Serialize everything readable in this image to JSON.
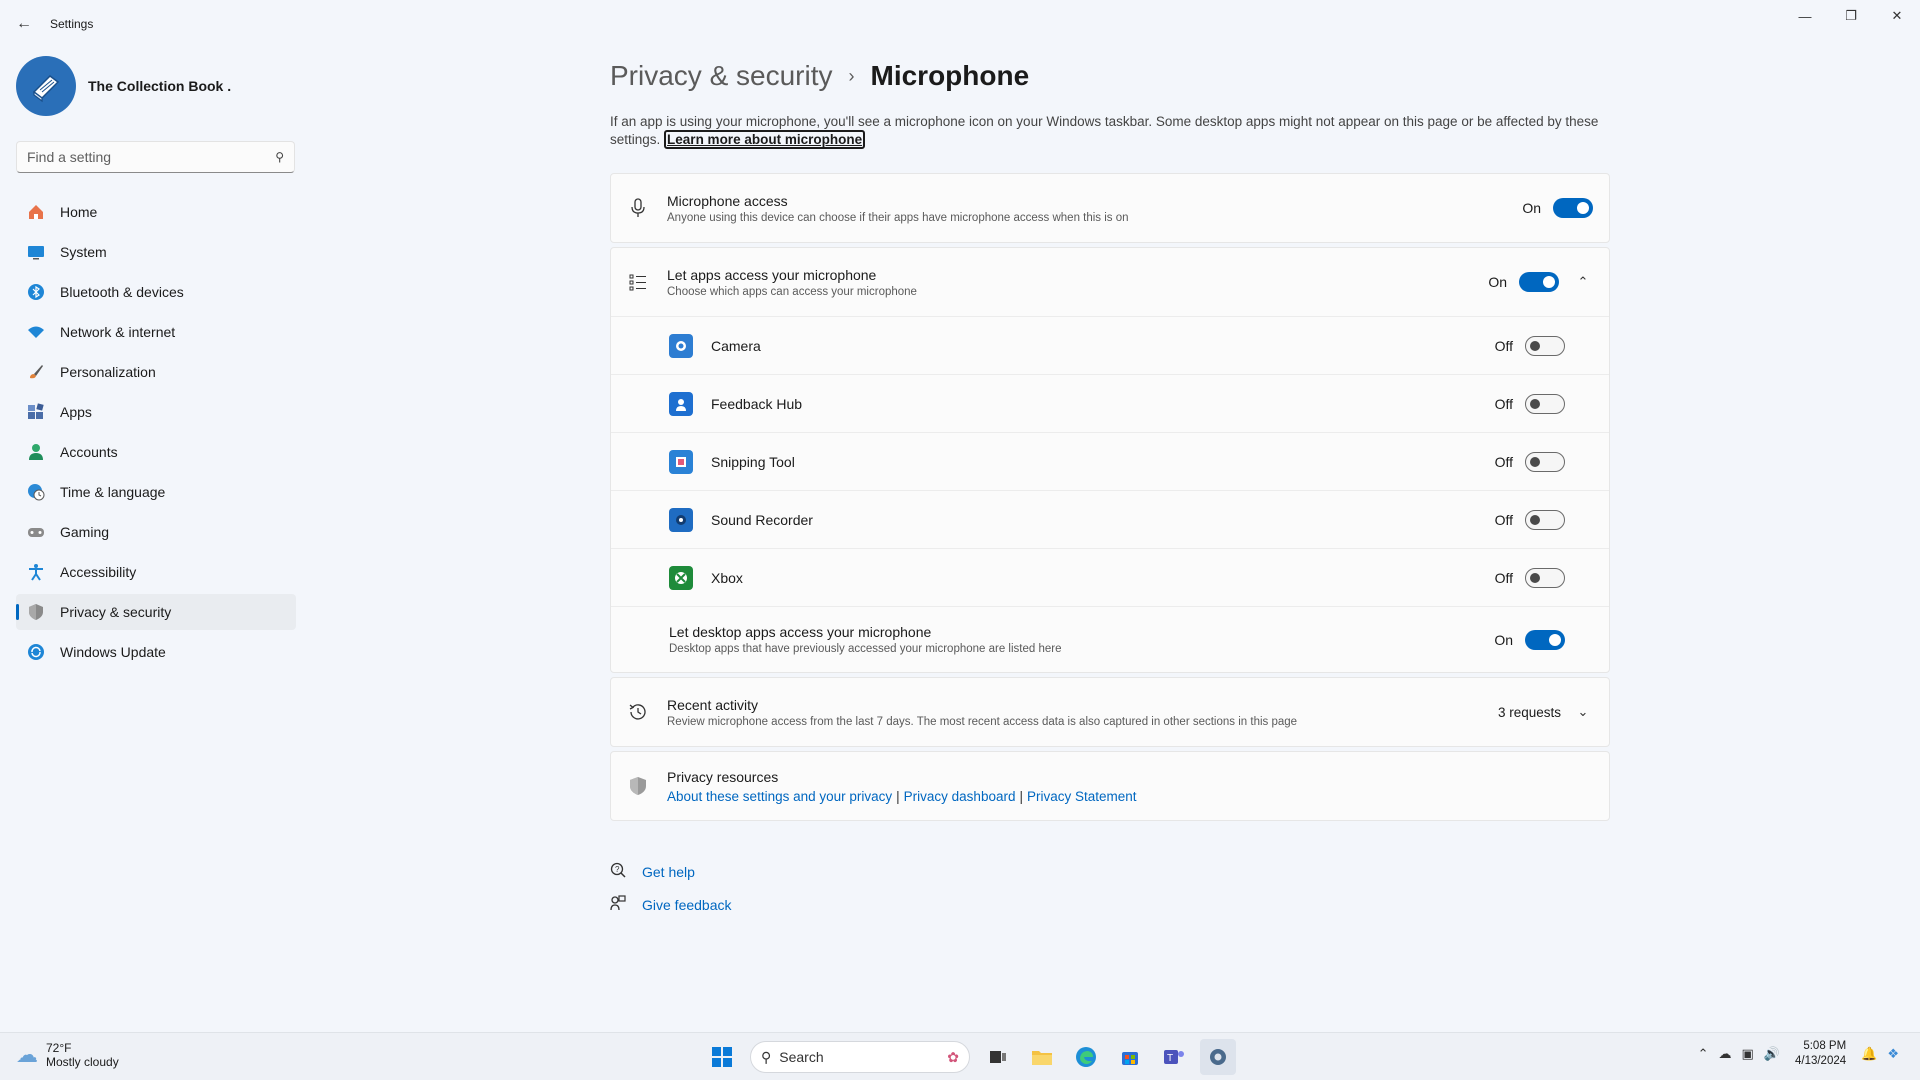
{
  "window": {
    "title": "Settings",
    "back_icon": "arrow-left-icon"
  },
  "profile": {
    "name": "The Collection Book ."
  },
  "search": {
    "placeholder": "Find a setting"
  },
  "sidebar": {
    "items": [
      {
        "label": "Home",
        "icon": "home-icon",
        "color": "#e8734a"
      },
      {
        "label": "System",
        "icon": "monitor-icon",
        "color": "#1e86d6"
      },
      {
        "label": "Bluetooth & devices",
        "icon": "bluetooth-icon",
        "color": "#1e86d6"
      },
      {
        "label": "Network & internet",
        "icon": "wifi-icon",
        "color": "#1e86d6"
      },
      {
        "label": "Personalization",
        "icon": "brush-icon",
        "color": "#e0823a"
      },
      {
        "label": "Apps",
        "icon": "apps-icon",
        "color": "#4a6da8"
      },
      {
        "label": "Accounts",
        "icon": "person-icon",
        "color": "#2ea86b"
      },
      {
        "label": "Time & language",
        "icon": "globe-clock-icon",
        "color": "#2b8ad6"
      },
      {
        "label": "Gaming",
        "icon": "gamepad-icon",
        "color": "#7a7a7a"
      },
      {
        "label": "Accessibility",
        "icon": "accessibility-icon",
        "color": "#1e86d6"
      },
      {
        "label": "Privacy & security",
        "icon": "shield-icon",
        "color": "#7a7a7a"
      },
      {
        "label": "Windows Update",
        "icon": "update-icon",
        "color": "#1e86d6"
      }
    ],
    "active_index": 10
  },
  "main": {
    "breadcrumb_parent": "Privacy & security",
    "breadcrumb_current": "Microphone",
    "intro_text": "If an app is using your microphone, you'll see a microphone icon on your Windows taskbar. Some desktop apps might not appear on this page or be affected by these settings.",
    "intro_link": "Learn more about microphone",
    "mic_access": {
      "title": "Microphone access",
      "subtitle": "Anyone using this device can choose if their apps have microphone access when this is on",
      "state": "On"
    },
    "let_apps": {
      "title": "Let apps access your microphone",
      "subtitle": "Choose which apps can access your microphone",
      "state": "On"
    },
    "apps": [
      {
        "name": "Camera",
        "state": "Off",
        "icon": "camera-app-icon",
        "color": "#2d7dd2"
      },
      {
        "name": "Feedback Hub",
        "state": "Off",
        "icon": "feedback-hub-icon",
        "color": "#1e6fd0"
      },
      {
        "name": "Snipping Tool",
        "state": "Off",
        "icon": "snipping-tool-icon",
        "color": "#2a82d6"
      },
      {
        "name": "Sound Recorder",
        "state": "Off",
        "icon": "sound-recorder-icon",
        "color": "#1f6cc2"
      },
      {
        "name": "Xbox",
        "state": "Off",
        "icon": "xbox-icon",
        "color": "#1e8b3a"
      }
    ],
    "desktop_apps": {
      "title": "Let desktop apps access your microphone",
      "subtitle": "Desktop apps that have previously accessed your microphone are listed here",
      "state": "On"
    },
    "recent_activity": {
      "title": "Recent activity",
      "subtitle": "Review microphone access from the last 7 days. The most recent access data is also captured in other sections in this page",
      "count": "3 requests"
    },
    "privacy_resources": {
      "title": "Privacy resources",
      "link1": "About these settings and your privacy",
      "link2": "Privacy dashboard",
      "link3": "Privacy Statement",
      "separator": "|"
    },
    "help": {
      "get_help": "Get help",
      "give_feedback": "Give feedback"
    }
  },
  "taskbar": {
    "weather_temp": "72°F",
    "weather_desc": "Mostly cloudy",
    "search_label": "Search",
    "time": "5:08 PM",
    "date": "4/13/2024"
  },
  "colors": {
    "accent": "#0067c0",
    "background": "#f3f6fb",
    "card": "#fbfbfb"
  }
}
